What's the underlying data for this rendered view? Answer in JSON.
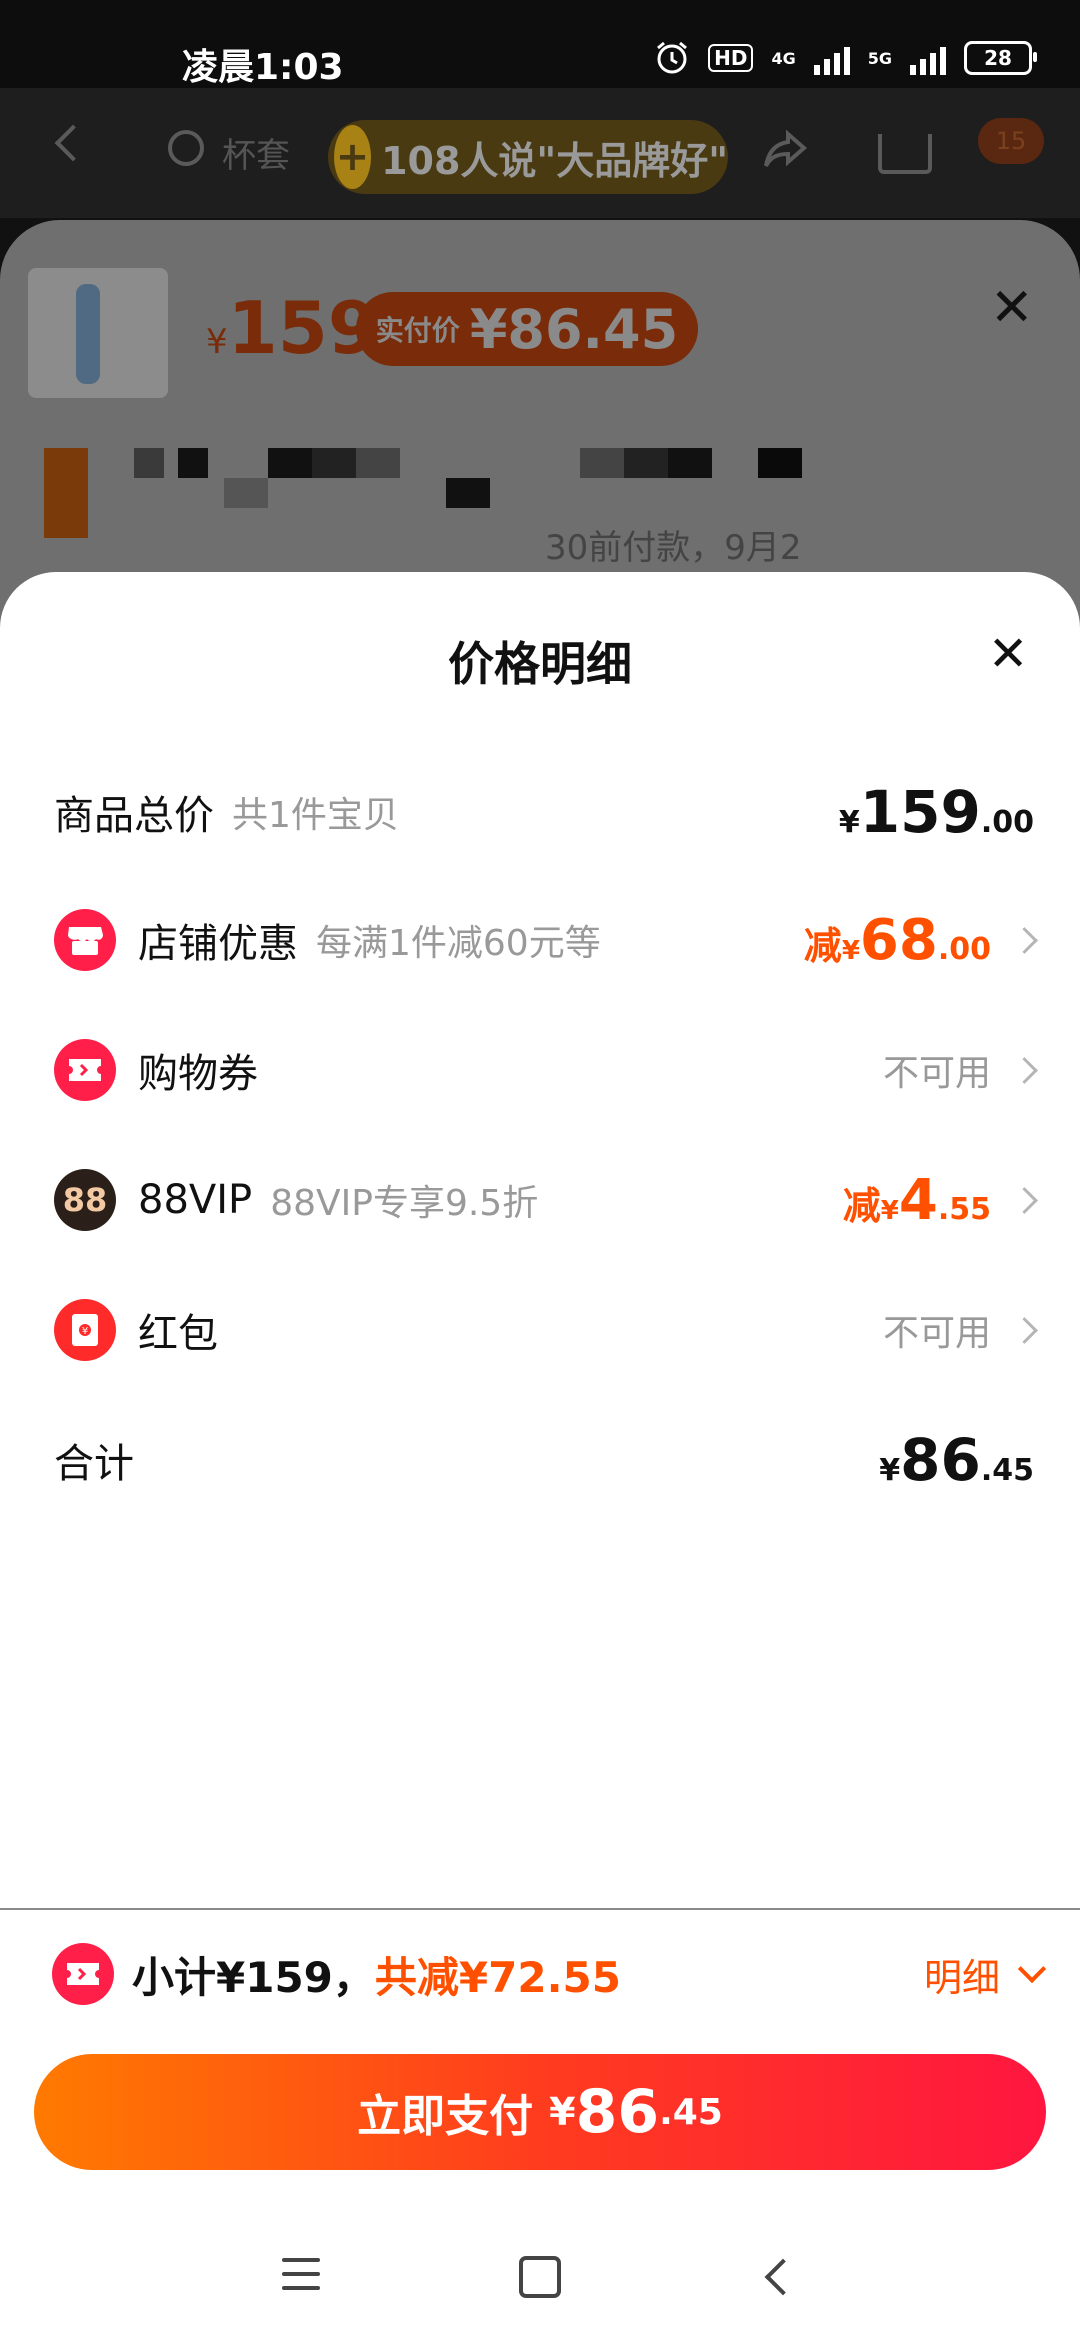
{
  "status_bar": {
    "time": "凌晨1:03",
    "hd": "HD",
    "net1": "4G",
    "net2": "5G",
    "battery": "28"
  },
  "top_bar": {
    "search_text": "杯套",
    "badge_text": "108人说\"大品牌好\"",
    "cart_count": "15"
  },
  "product": {
    "currency": "¥",
    "price": "159",
    "pay_label": "实付价",
    "pay_amount": "¥86.45",
    "snippet": "30前付款，9月2"
  },
  "price_sheet": {
    "title": "价格明细",
    "total": {
      "label": "商品总价",
      "sub": "共1件宝贝",
      "currency": "¥",
      "int": "159",
      "dec": ".00"
    },
    "shop_discount": {
      "label": "店铺优惠",
      "sub": "每满1件减60元等",
      "prefix": "减",
      "currency": "¥",
      "int": "68",
      "dec": ".00"
    },
    "coupon": {
      "label": "购物券",
      "value": "不可用"
    },
    "vip": {
      "icon_text": "88",
      "label": "88VIP",
      "sub": "88VIP专享9.5折",
      "prefix": "减",
      "currency": "¥",
      "int": "4",
      "dec": ".55"
    },
    "red_packet": {
      "label": "红包",
      "value": "不可用"
    },
    "sum": {
      "label": "合计",
      "currency": "¥",
      "int": "86",
      "dec": ".45"
    }
  },
  "summary": {
    "subtotal": "小计¥159，",
    "reduced": "共减¥72.55",
    "detail": "明细"
  },
  "pay_button": {
    "label": "立即支付",
    "currency": "¥",
    "int": "86",
    "dec": ".45"
  },
  "colors": {
    "accent": "#ff5000",
    "brand_red": "#ff1f48",
    "vip_dark": "#2b1f1a"
  }
}
